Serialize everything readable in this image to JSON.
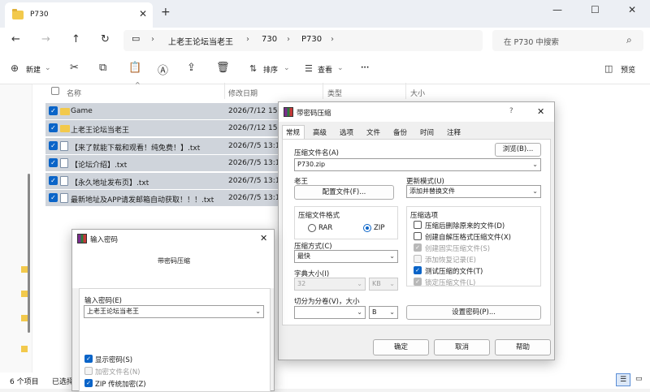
{
  "tab": {
    "title": "P730",
    "close": "✕",
    "new": "+"
  },
  "window_controls": {
    "minimize": "—",
    "maximize": "☐",
    "close": "✕"
  },
  "nav": {
    "breadcrumb": [
      "上老王论坛当老王",
      "730",
      "P730"
    ],
    "search_placeholder": "在 P730 中搜索"
  },
  "toolbar": {
    "new_label": "新建",
    "sort_label": "排序",
    "view_label": "查看",
    "more": "···",
    "preview_label": "预览"
  },
  "columns": {
    "name": "名称",
    "date": "修改日期",
    "type": "类型",
    "size": "大小"
  },
  "files": [
    {
      "name": "Game",
      "date": "2026/7/12 15:",
      "kind": "folder"
    },
    {
      "name": "上老王论坛当老王",
      "date": "2026/7/12 15:",
      "kind": "folder"
    },
    {
      "name": "【来了就能下载和观看！纯免费！】.txt",
      "date": "2026/7/5 13:1",
      "kind": "file"
    },
    {
      "name": "【论坛介绍】.txt",
      "date": "2026/7/5 13:1",
      "kind": "file"
    },
    {
      "name": "【永久地址发布页】.txt",
      "date": "2026/7/5 13:1",
      "kind": "file"
    },
    {
      "name": "最新地址及APP请发邮箱自动获取！！！.txt",
      "date": "2026/7/5 13:1",
      "kind": "file"
    }
  ],
  "status": {
    "count": "6 个项目",
    "selected": "已选择"
  },
  "archive_dialog": {
    "title": "带密码压缩",
    "help_glyph": "?",
    "tabs": [
      "常规",
      "高级",
      "选项",
      "文件",
      "备份",
      "时间",
      "注释"
    ],
    "archive_name_label": "压缩文件名(A)",
    "browse_button": "浏览(B)...",
    "archive_name": "P730.zip",
    "profile_label": "老王",
    "profile_button": "配置文件(F)...",
    "update_mode_label": "更新模式(U)",
    "update_mode": "添加并替换文件",
    "format_group": "压缩文件格式",
    "format_rar": "RAR",
    "format_zip": "ZIP",
    "options_group": "压缩选项",
    "options": [
      {
        "label": "压缩后删除原来的文件(D)",
        "checked": false,
        "disabled": false
      },
      {
        "label": "创建自解压格式压缩文件(X)",
        "checked": false,
        "disabled": false
      },
      {
        "label": "创建固实压缩文件(S)",
        "checked": true,
        "disabled": true
      },
      {
        "label": "添加恢复记录(E)",
        "checked": false,
        "disabled": true
      },
      {
        "label": "测试压缩的文件(T)",
        "checked": true,
        "disabled": false
      },
      {
        "label": "锁定压缩文件(L)",
        "checked": true,
        "disabled": true
      }
    ],
    "method_label": "压缩方式(C)",
    "method": "最快",
    "dict_label": "字典大小(I)",
    "dict_value": "32",
    "dict_unit": "KB",
    "split_label": "切分为分卷(V)，大小",
    "split_unit": "B",
    "set_password_button": "设置密码(P)...",
    "ok_button": "确定",
    "cancel_button": "取消",
    "help_button": "帮助"
  },
  "password_dialog": {
    "title": "输入密码",
    "subtitle": "带密码压缩",
    "enter_label": "输入密码(E)",
    "password_value": "上老王论坛当老王",
    "show_password": "显示密码(S)",
    "encrypt_names": "加密文件名(N)",
    "zip_legacy": "ZIP 传统加密(Z)"
  }
}
